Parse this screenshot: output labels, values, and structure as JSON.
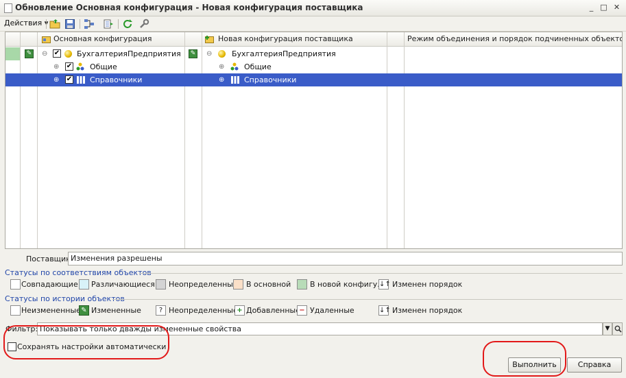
{
  "window": {
    "title": "Обновление Основная конфигурация - Новая конфигурация поставщика",
    "minimize_glyph": "_",
    "maximize_glyph": "□",
    "close_glyph": "✕",
    "icons": [
      "document-icon"
    ]
  },
  "toolbar": {
    "actions_label": "Действия ▾",
    "icons": [
      "open-folder-icon",
      "save-icon",
      "tree-diff-icon",
      "list-export-icon",
      "refresh-icon",
      "settings-wrench-icon"
    ]
  },
  "grid": {
    "columns": {
      "main": "Основная конфигурация",
      "new": "Новая конфигурация поставщика",
      "mode": "Режим объединения и порядок подчиненных объектов"
    },
    "rows": [
      {
        "expander": "⊖",
        "checked": "✔",
        "name_main": "БухгалтерияПредприятия",
        "name_new": "БухгалтерияПредприятия",
        "selected": false
      },
      {
        "expander": "⊕",
        "checked": "✔",
        "name_main": "Общие",
        "name_new": "Общие",
        "selected": false
      },
      {
        "expander": "⊕",
        "checked": "✔",
        "name_main": "Справочники",
        "name_new": "Справочники",
        "selected": true
      }
    ]
  },
  "provider": {
    "label": "Поставщик:",
    "value": "Изменения разрешены"
  },
  "status_match": {
    "title": "Статусы по соответствиям объектов",
    "items": [
      {
        "label": "Совпадающие",
        "color": "#ffffff"
      },
      {
        "label": "Различающиеся",
        "color": "#d8f2f8"
      },
      {
        "label": "Неопределенные",
        "color": "#d4d4d4"
      },
      {
        "label": "В основной",
        "color": "#fbe0c8"
      },
      {
        "label": "В новой конфигу...",
        "color": "#b8dcb8"
      },
      {
        "label": "Изменен порядок",
        "color": "#ffffff"
      }
    ]
  },
  "status_history": {
    "title": "Статусы по истории объектов",
    "items": [
      {
        "label": "Неизмененные",
        "glyph": ""
      },
      {
        "label": "Измененные",
        "glyph": "✎"
      },
      {
        "label": "Неопределенные",
        "glyph": "?"
      },
      {
        "label": "Добавленные",
        "glyph": "+"
      },
      {
        "label": "Удаленные",
        "glyph": "−"
      },
      {
        "label": "Изменен порядок",
        "glyph": "↓↑"
      }
    ]
  },
  "filter": {
    "label": "Фильтр:",
    "value": "Показывать только дважды измененные свойства",
    "dropdown_glyph": "▼"
  },
  "autosave": {
    "label": "Сохранять настройки автоматически",
    "checked": false
  },
  "buttons": {
    "run": "Выполнить",
    "help": "Справка"
  },
  "colors": {
    "selection": "#3a5cc8",
    "annotation": "#e21818",
    "section_title": "#1f44a8"
  }
}
